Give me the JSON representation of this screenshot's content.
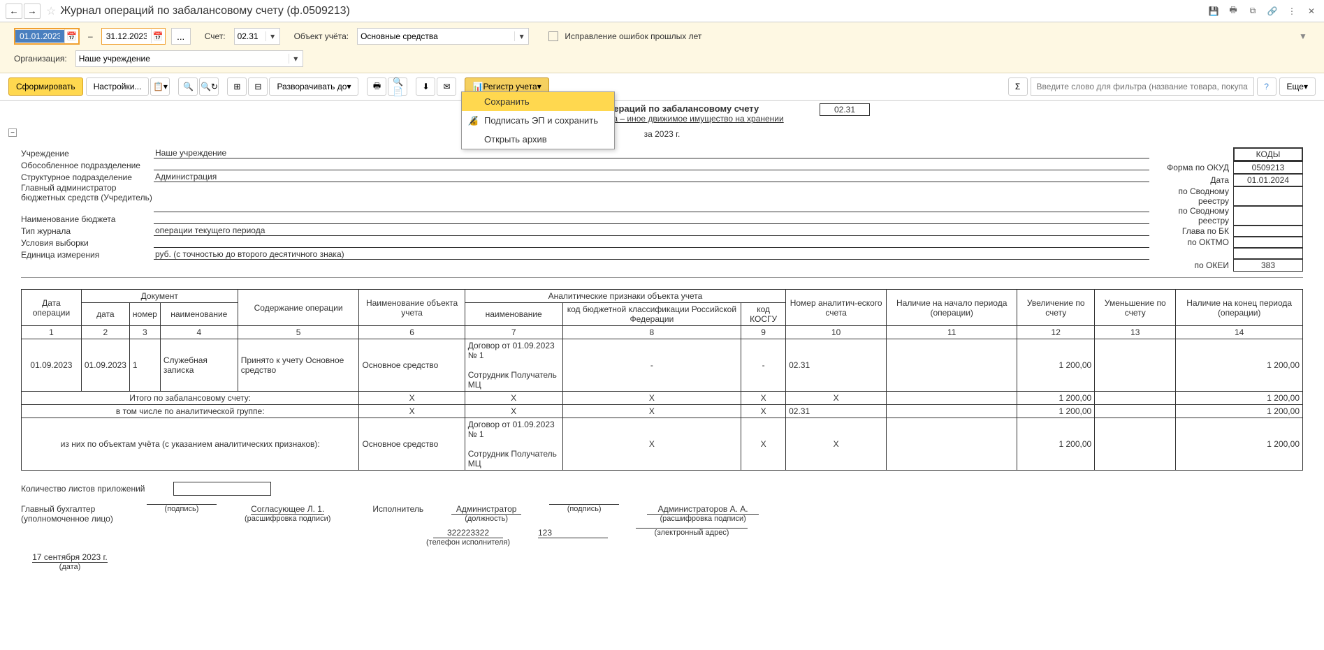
{
  "title": "Журнал операций по забалансовому счету (ф.0509213)",
  "filter": {
    "date_from": "01.01.2023",
    "date_to": "31.12.2023",
    "account_label": "Счет:",
    "account_value": "02.31",
    "object_label": "Объект учёта:",
    "object_value": "Основные средства",
    "errors_checkbox": "Исправление ошибок прошлых лет",
    "org_label": "Организация:",
    "org_value": "Наше учреждение"
  },
  "toolbar": {
    "form": "Сформировать",
    "settings": "Настройки...",
    "expand": "Разворачивать до",
    "register": "Регистр учета",
    "filter_placeholder": "Введите слово для фильтра (название товара, покупателя и пр.)",
    "more": "Еще"
  },
  "dropdown": {
    "save": "Сохранить",
    "sign": "Подписать ЭП и сохранить",
    "archive": "Открыть архив"
  },
  "report": {
    "title": "Журнал операций по забалансовому счету",
    "subtitle": "Основные средства – иное движимое имущество на хранении",
    "account_display": "02.31",
    "period": "за 2023 г.",
    "fields": {
      "institution_label": "Учреждение",
      "institution_value": "Наше учреждение",
      "subdivision_label": "Обособленное подразделение",
      "subdivision_value": "",
      "struct_label": "Структурное подразделение",
      "struct_value": "Администрация",
      "admin_label": "Главный администратор бюджетных средств (Учредитель)",
      "admin_value": "",
      "budget_label": "Наименование бюджета",
      "budget_value": "",
      "journal_type_label": "Тип журнала",
      "journal_type_value": "операции текущего периода",
      "selection_label": "Условия выборки",
      "selection_value": "",
      "unit_label": "Единица измерения",
      "unit_value": "руб. (с точностью до второго десятичного знака)"
    },
    "codes": {
      "header": "КОДЫ",
      "okud_label": "Форма по ОКУД",
      "okud": "0509213",
      "date_label": "Дата",
      "date": "01.01.2024",
      "svod1_label": "по Сводному реестру",
      "svod2_label": "по Сводному реестру",
      "glava_label": "Глава по БК",
      "oktmo_label": "по ОКТМО",
      "okei_label": "по ОКЕИ",
      "okei": "383"
    }
  },
  "table": {
    "headers": {
      "op_date": "Дата операции",
      "document": "Документ",
      "doc_date": "дата",
      "doc_num": "номер",
      "doc_name": "наименование",
      "content": "Содержание операции",
      "obj_name": "Наименование объекта учета",
      "analytics": "Аналитические признаки объекта учета",
      "analytics_name": "наименование",
      "budget_class": "код бюджетной классификации Российской Федерации",
      "kosgu": "код КОСГУ",
      "acc_num": "Номер аналитич-еского счета",
      "start": "Наличие на начало периода (операции)",
      "increase": "Увеличение по счету",
      "decrease": "Уменьшение по счету",
      "end": "Наличие на конец периода (операции)"
    },
    "col_nums": [
      "1",
      "2",
      "3",
      "4",
      "5",
      "6",
      "7",
      "8",
      "9",
      "10",
      "11",
      "12",
      "13",
      "14"
    ],
    "rows": [
      {
        "op_date": "01.09.2023",
        "doc_date": "01.09.2023",
        "doc_num": "1",
        "doc_name": "Служебная записка",
        "content": "Принято к учету Основное средство",
        "obj_name": "Основное средство",
        "analytics_name": "Договор от 01.09.2023 № 1\n\nСотрудник Получатель МЦ",
        "budget_class": "-",
        "kosgu": "-",
        "acc_num": "02.31",
        "start": "",
        "increase": "1 200,00",
        "decrease": "",
        "end": "1 200,00"
      }
    ],
    "totals": {
      "total_label": "Итого по забалансовому счету:",
      "group_label": "в том числе по аналитической группе:",
      "objects_label": "из них по объектам учёта (с указанием аналитических признаков):",
      "total_vals": [
        "Х",
        "Х",
        "Х",
        "Х",
        "Х",
        "",
        "1 200,00",
        "",
        "1 200,00"
      ],
      "group_vals": [
        "Х",
        "Х",
        "Х",
        "Х",
        "02.31",
        "",
        "1 200,00",
        "",
        "1 200,00"
      ],
      "obj_vals": [
        "Основное средство",
        "Договор от 01.09.2023 № 1\n\nСотрудник Получатель МЦ",
        "Х",
        "Х",
        "Х",
        "",
        "1 200,00",
        "",
        "1 200,00"
      ]
    }
  },
  "footer": {
    "attachments_label": "Количество листов приложений",
    "accountant_label": "Главный бухгалтер (уполномоченное лицо)",
    "signature_caption": "(подпись)",
    "approver": "Согласующее Л. 1.",
    "decode_caption": "(расшифровка подписи)",
    "executor_label": "Исполнитель",
    "executor_name": "Администратор",
    "position_caption": "(должность)",
    "admin_name": "Администраторов А. А.",
    "phone": "322223322",
    "phone_caption": "(телефон исполнителя)",
    "code_123": "123",
    "email_caption": "(электронный адрес)",
    "sign_date": "17 сентября 2023 г.",
    "date_caption": "(дата)"
  }
}
